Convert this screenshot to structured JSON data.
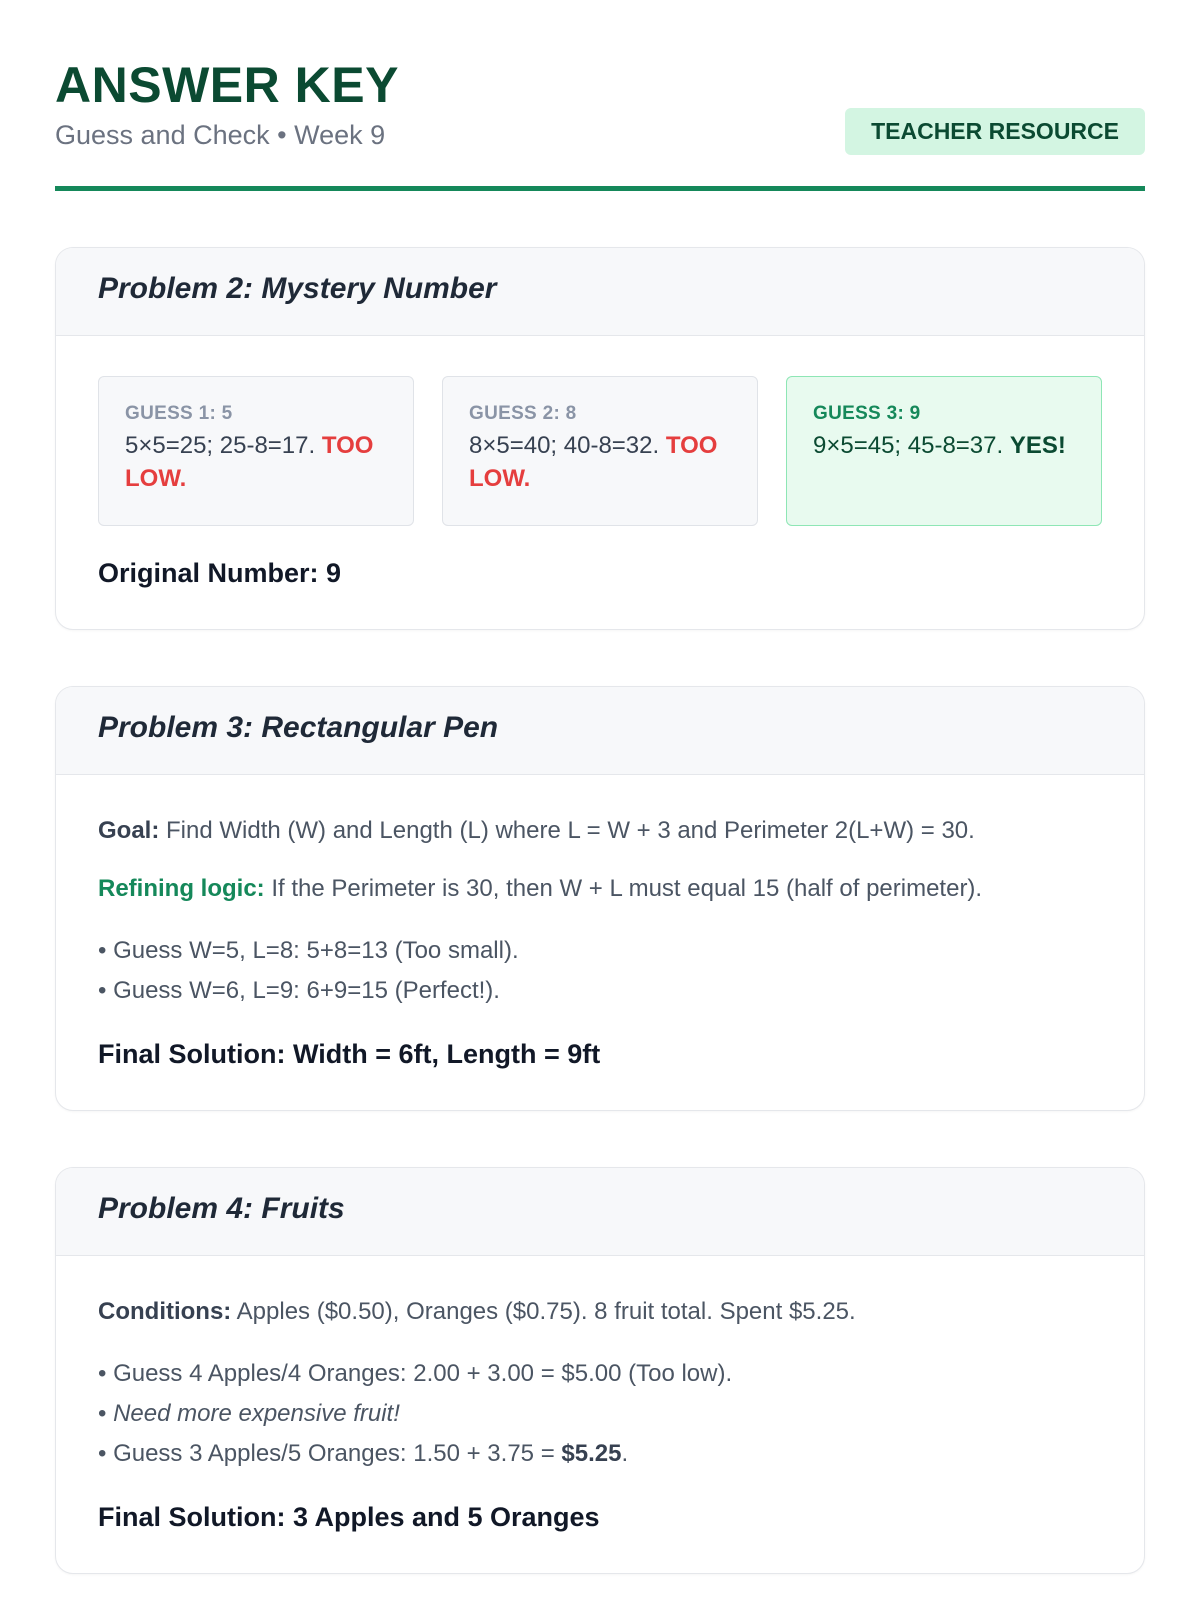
{
  "header": {
    "title": "ANSWER KEY",
    "subtitle": "Guess and Check • Week 9",
    "badge": "TEACHER RESOURCE"
  },
  "problem2": {
    "title": "Problem 2: Mystery Number",
    "guesses": [
      {
        "label": "GUESS 1: 5",
        "text": "5×5=25; 25-8=17. ",
        "verdict": "TOO LOW."
      },
      {
        "label": "GUESS 2: 8",
        "text": "8×5=40; 40-8=32. ",
        "verdict": "TOO LOW."
      },
      {
        "label": "GUESS 3: 9",
        "text": "9×5=45; 45-8=37. ",
        "verdict": "YES!"
      }
    ],
    "result": "Original Number: 9"
  },
  "problem3": {
    "title": "Problem 3: Rectangular Pen",
    "goal_label": "Goal:",
    "goal_text": " Find Width (W) and Length (L) where L = W + 3 and Perimeter 2(L+W) = 30.",
    "logic_label": "Refining logic:",
    "logic_text": " If the Perimeter is 30, then W + L must equal 15 (half of perimeter).",
    "bullets": [
      "• Guess W=5, L=8: 5+8=13 (Too small).",
      "• Guess W=6, L=9: 6+9=15 (Perfect!)."
    ],
    "final": "Final Solution: Width = 6ft, Length = 9ft"
  },
  "problem4": {
    "title": "Problem 4: Fruits",
    "cond_label": "Conditions:",
    "cond_text": " Apples ($0.50), Oranges ($0.75). 8 fruit total. Spent $5.25.",
    "bullet1": "• Guess 4 Apples/4 Oranges: 2.00 + 3.00 = $5.00 (Too low).",
    "bullet2_prefix": "• ",
    "bullet2_italic": "Need more expensive fruit!",
    "bullet3_prefix": "• Guess 3 Apples/5 Oranges: 1.50 + 3.75 = ",
    "bullet3_bold": "$5.25",
    "bullet3_suffix": ".",
    "final": "Final Solution: 3 Apples and 5 Oranges"
  }
}
